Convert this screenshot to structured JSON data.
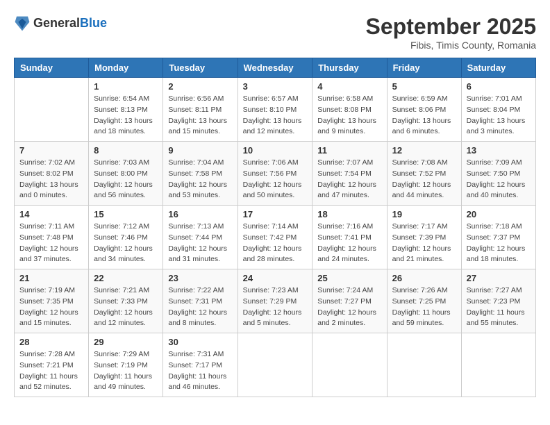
{
  "header": {
    "logo_line1": "General",
    "logo_line2": "Blue",
    "month_title": "September 2025",
    "subtitle": "Fibis, Timis County, Romania"
  },
  "days_of_week": [
    "Sunday",
    "Monday",
    "Tuesday",
    "Wednesday",
    "Thursday",
    "Friday",
    "Saturday"
  ],
  "weeks": [
    [
      {
        "day": "",
        "info": ""
      },
      {
        "day": "1",
        "info": "Sunrise: 6:54 AM\nSunset: 8:13 PM\nDaylight: 13 hours\nand 18 minutes."
      },
      {
        "day": "2",
        "info": "Sunrise: 6:56 AM\nSunset: 8:11 PM\nDaylight: 13 hours\nand 15 minutes."
      },
      {
        "day": "3",
        "info": "Sunrise: 6:57 AM\nSunset: 8:10 PM\nDaylight: 13 hours\nand 12 minutes."
      },
      {
        "day": "4",
        "info": "Sunrise: 6:58 AM\nSunset: 8:08 PM\nDaylight: 13 hours\nand 9 minutes."
      },
      {
        "day": "5",
        "info": "Sunrise: 6:59 AM\nSunset: 8:06 PM\nDaylight: 13 hours\nand 6 minutes."
      },
      {
        "day": "6",
        "info": "Sunrise: 7:01 AM\nSunset: 8:04 PM\nDaylight: 13 hours\nand 3 minutes."
      }
    ],
    [
      {
        "day": "7",
        "info": "Sunrise: 7:02 AM\nSunset: 8:02 PM\nDaylight: 13 hours\nand 0 minutes."
      },
      {
        "day": "8",
        "info": "Sunrise: 7:03 AM\nSunset: 8:00 PM\nDaylight: 12 hours\nand 56 minutes."
      },
      {
        "day": "9",
        "info": "Sunrise: 7:04 AM\nSunset: 7:58 PM\nDaylight: 12 hours\nand 53 minutes."
      },
      {
        "day": "10",
        "info": "Sunrise: 7:06 AM\nSunset: 7:56 PM\nDaylight: 12 hours\nand 50 minutes."
      },
      {
        "day": "11",
        "info": "Sunrise: 7:07 AM\nSunset: 7:54 PM\nDaylight: 12 hours\nand 47 minutes."
      },
      {
        "day": "12",
        "info": "Sunrise: 7:08 AM\nSunset: 7:52 PM\nDaylight: 12 hours\nand 44 minutes."
      },
      {
        "day": "13",
        "info": "Sunrise: 7:09 AM\nSunset: 7:50 PM\nDaylight: 12 hours\nand 40 minutes."
      }
    ],
    [
      {
        "day": "14",
        "info": "Sunrise: 7:11 AM\nSunset: 7:48 PM\nDaylight: 12 hours\nand 37 minutes."
      },
      {
        "day": "15",
        "info": "Sunrise: 7:12 AM\nSunset: 7:46 PM\nDaylight: 12 hours\nand 34 minutes."
      },
      {
        "day": "16",
        "info": "Sunrise: 7:13 AM\nSunset: 7:44 PM\nDaylight: 12 hours\nand 31 minutes."
      },
      {
        "day": "17",
        "info": "Sunrise: 7:14 AM\nSunset: 7:42 PM\nDaylight: 12 hours\nand 28 minutes."
      },
      {
        "day": "18",
        "info": "Sunrise: 7:16 AM\nSunset: 7:41 PM\nDaylight: 12 hours\nand 24 minutes."
      },
      {
        "day": "19",
        "info": "Sunrise: 7:17 AM\nSunset: 7:39 PM\nDaylight: 12 hours\nand 21 minutes."
      },
      {
        "day": "20",
        "info": "Sunrise: 7:18 AM\nSunset: 7:37 PM\nDaylight: 12 hours\nand 18 minutes."
      }
    ],
    [
      {
        "day": "21",
        "info": "Sunrise: 7:19 AM\nSunset: 7:35 PM\nDaylight: 12 hours\nand 15 minutes."
      },
      {
        "day": "22",
        "info": "Sunrise: 7:21 AM\nSunset: 7:33 PM\nDaylight: 12 hours\nand 12 minutes."
      },
      {
        "day": "23",
        "info": "Sunrise: 7:22 AM\nSunset: 7:31 PM\nDaylight: 12 hours\nand 8 minutes."
      },
      {
        "day": "24",
        "info": "Sunrise: 7:23 AM\nSunset: 7:29 PM\nDaylight: 12 hours\nand 5 minutes."
      },
      {
        "day": "25",
        "info": "Sunrise: 7:24 AM\nSunset: 7:27 PM\nDaylight: 12 hours\nand 2 minutes."
      },
      {
        "day": "26",
        "info": "Sunrise: 7:26 AM\nSunset: 7:25 PM\nDaylight: 11 hours\nand 59 minutes."
      },
      {
        "day": "27",
        "info": "Sunrise: 7:27 AM\nSunset: 7:23 PM\nDaylight: 11 hours\nand 55 minutes."
      }
    ],
    [
      {
        "day": "28",
        "info": "Sunrise: 7:28 AM\nSunset: 7:21 PM\nDaylight: 11 hours\nand 52 minutes."
      },
      {
        "day": "29",
        "info": "Sunrise: 7:29 AM\nSunset: 7:19 PM\nDaylight: 11 hours\nand 49 minutes."
      },
      {
        "day": "30",
        "info": "Sunrise: 7:31 AM\nSunset: 7:17 PM\nDaylight: 11 hours\nand 46 minutes."
      },
      {
        "day": "",
        "info": ""
      },
      {
        "day": "",
        "info": ""
      },
      {
        "day": "",
        "info": ""
      },
      {
        "day": "",
        "info": ""
      }
    ]
  ]
}
